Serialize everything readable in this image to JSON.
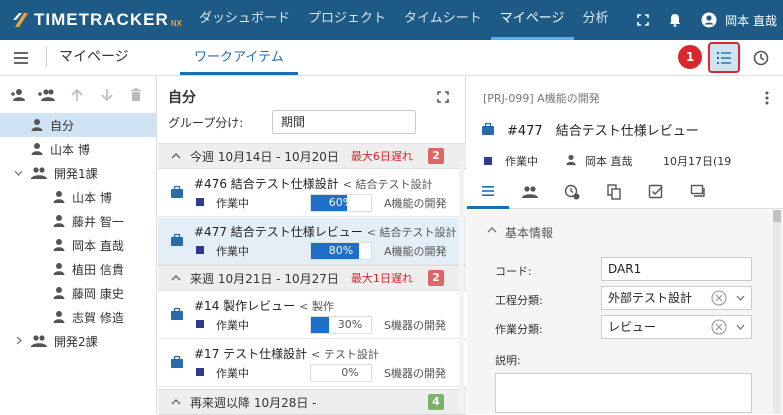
{
  "app": {
    "logo_text": "TIMETRACKER",
    "logo_sub": "NX",
    "nav": [
      "ダッシュボード",
      "プロジェクト",
      "タイムシート",
      "マイページ",
      "分析"
    ],
    "active_nav": "マイページ",
    "user_name": "岡本 直哉"
  },
  "subbar": {
    "page_title": "マイページ",
    "tab_label": "ワークアイテム",
    "callout_badge": "1"
  },
  "tree": {
    "items": [
      {
        "label": "自分",
        "type": "user",
        "selected": true
      },
      {
        "label": "山本 博",
        "type": "user"
      },
      {
        "label": "開発1課",
        "type": "group",
        "expanded": true
      },
      {
        "label": "山本 博",
        "type": "user",
        "child": true
      },
      {
        "label": "藤井 智一",
        "type": "user",
        "child": true
      },
      {
        "label": "岡本 直哉",
        "type": "user",
        "child": true
      },
      {
        "label": "植田 信貴",
        "type": "user",
        "child": true
      },
      {
        "label": "藤岡 康史",
        "type": "user",
        "child": true
      },
      {
        "label": "志賀 修造",
        "type": "user",
        "child": true
      },
      {
        "label": "開発2課",
        "type": "group",
        "expanded": false
      }
    ]
  },
  "middle": {
    "title": "自分",
    "group_label": "グループ分け:",
    "group_value": "期間",
    "groups": [
      {
        "label": "今週 10月14日 - 10月20日",
        "warn": "最大6日遅れ",
        "count": "2",
        "count_color": "#e06666"
      },
      {
        "label": "来週 10月21日 - 10月27日",
        "warn": "最大1日遅れ",
        "count": "2",
        "count_color": "#e06666"
      },
      {
        "label": "再来週以降 10月28日 -",
        "warn": "",
        "count": "4",
        "count_color": "#7cb36a"
      }
    ],
    "cards": [
      {
        "title": "#476 結合テスト仕様設計",
        "parent": "< 結合テスト設計",
        "status": "作業中",
        "progress": 60,
        "progress_label": "60%",
        "project": "A機能の開発",
        "selected": false
      },
      {
        "title": "#477 結合テスト仕様レビュー",
        "parent": "< 結合テスト設計",
        "status": "作業中",
        "progress": 80,
        "progress_label": "80%",
        "project": "A機能の開発",
        "selected": true
      },
      {
        "title": "#14 製作レビュー",
        "parent": "< 製作",
        "status": "作業中",
        "progress": 30,
        "progress_label": "30%",
        "project": "S機器の開発",
        "selected": false
      },
      {
        "title": "#17 テスト仕様設計",
        "parent": "< テスト設計",
        "status": "作業中",
        "progress": 0,
        "progress_label": "0%",
        "project": "S機器の開発",
        "selected": false
      }
    ]
  },
  "detail": {
    "breadcrumb": "[PRJ-099] A機能の開発",
    "title": "#477　結合テスト仕様レビュー",
    "status": "作業中",
    "assignee": "岡本 直哉",
    "date": "10月17日(19",
    "section": "基本情報",
    "fields": [
      {
        "label": "コード:",
        "value": "DAR1",
        "dropdown": false
      },
      {
        "label": "工程分類:",
        "value": "外部テスト設計",
        "dropdown": true
      },
      {
        "label": "作業分類:",
        "value": "レビュー",
        "dropdown": true
      }
    ],
    "description_label": "説明:"
  },
  "colors": {
    "topbar": "#1d5a86",
    "accent": "#1d6fb3",
    "highlight": "#d9272e",
    "progress": "#1d6fc9",
    "status": "#2e3a8c"
  }
}
